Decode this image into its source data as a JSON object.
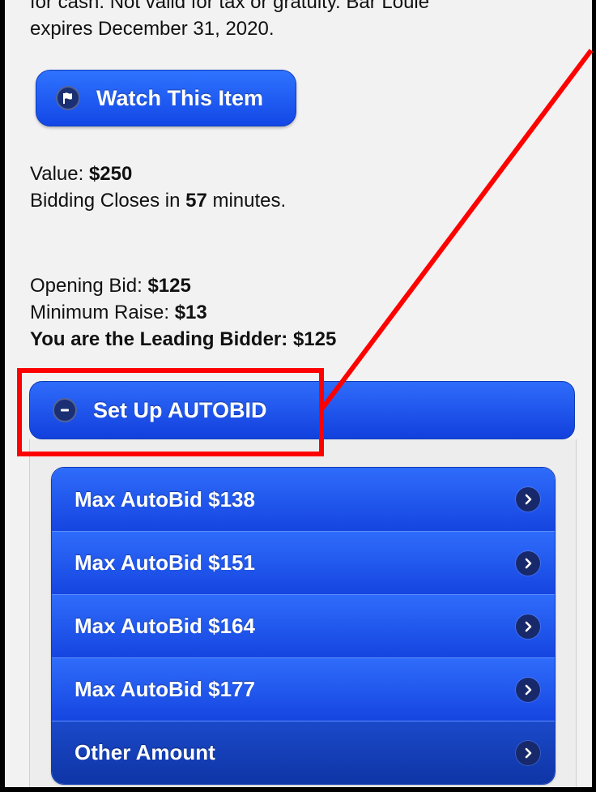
{
  "description": {
    "line1": "for cash. Not valid for tax or gratuity. Bar Louie",
    "line2": "expires December 31, 2020."
  },
  "watch_button": {
    "label": "Watch This Item",
    "icon": "flag-icon"
  },
  "value": {
    "label": "Value:",
    "amount": "$250"
  },
  "closing": {
    "prefix": "Bidding Closes in",
    "minutes": "57",
    "suffix": "minutes."
  },
  "opening_bid": {
    "label": "Opening Bid:",
    "amount": "$125"
  },
  "minimum_raise": {
    "label": "Minimum Raise:",
    "amount": "$13"
  },
  "leading": {
    "label": "You are the Leading Bidder:",
    "amount": "$125"
  },
  "autobid": {
    "label": "Set Up AUTOBID",
    "icon": "minus-circle-icon",
    "options": [
      {
        "label": "Max AutoBid $138"
      },
      {
        "label": "Max AutoBid $151"
      },
      {
        "label": "Max AutoBid $164"
      },
      {
        "label": "Max AutoBid $177"
      },
      {
        "label": "Other Amount"
      }
    ]
  },
  "colors": {
    "button_blue": "#1f5cf5",
    "annotation_red": "#ff0000"
  }
}
